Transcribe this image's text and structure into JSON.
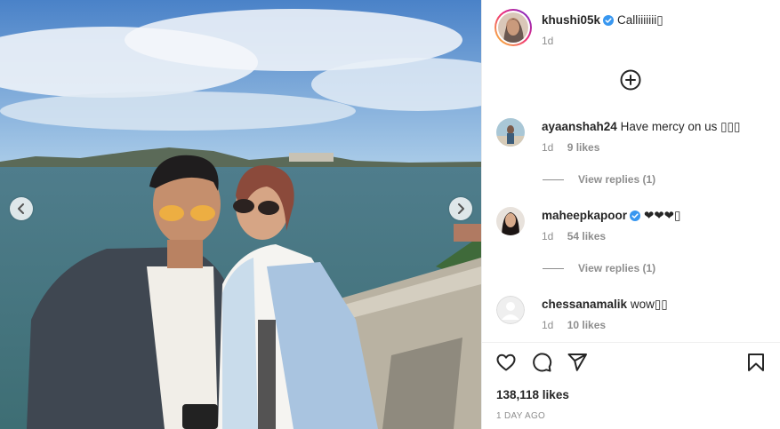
{
  "post": {
    "author": {
      "username": "khushi05k",
      "verified": true,
      "caption": "Calliiiiiii▯",
      "time": "1d",
      "avatar": "avatar-photo"
    },
    "media": {
      "prev_icon": "chevron-left-icon",
      "next_icon": "chevron-right-icon",
      "description_icon": "photo"
    },
    "add_comment_icon": "plus-circle-icon",
    "comments": [
      {
        "username": "ayaanshah24",
        "verified": false,
        "text": "Have mercy on us ▯▯▯",
        "time": "1d",
        "likes": "9 likes",
        "view_replies": "View replies (1)"
      },
      {
        "username": "maheepkapoor",
        "verified": true,
        "text": "❤❤❤▯",
        "time": "1d",
        "likes": "54 likes",
        "view_replies": "View replies (1)"
      },
      {
        "username": "chessanamalik",
        "verified": false,
        "text": "wow▯▯",
        "time": "1d",
        "likes": "10 likes"
      }
    ],
    "actions": {
      "like_icon": "heart-icon",
      "comment_icon": "comment-icon",
      "share_icon": "share-icon",
      "save_icon": "bookmark-icon"
    },
    "like_count": "138,118 likes",
    "posted": "1 DAY AGO",
    "colors": {
      "verified": "#3897f0",
      "text": "#262626",
      "muted": "#8e8e8e"
    }
  }
}
